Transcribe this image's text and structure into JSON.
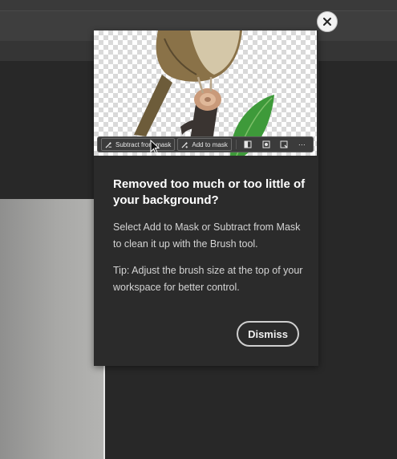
{
  "coachmark": {
    "heading": "Removed too much or too little of your background?",
    "paragraph1": "Select Add to Mask or Subtract from Mask to clean it up with the Brush tool.",
    "paragraph2": "Tip: Adjust the brush size at the top of your workspace for better control.",
    "dismiss_label": "Dismiss",
    "close_icon": "close-icon"
  },
  "preview_toolbar": {
    "subtract_label": "Subtract from mask",
    "add_label": "Add to mask",
    "more_label": "⋯"
  },
  "colors": {
    "panel_bg": "#2b2b2b",
    "workspace_bg": "#282828",
    "text_primary": "#ffffff",
    "text_secondary": "#d4d4d4"
  }
}
